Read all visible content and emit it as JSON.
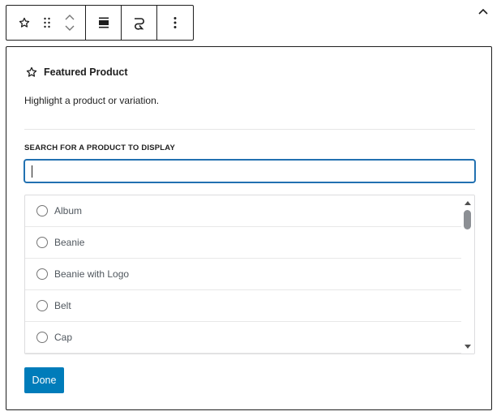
{
  "block": {
    "title": "Featured Product",
    "description": "Highlight a product or variation.",
    "search_label": "SEARCH FOR A PRODUCT TO DISPLAY",
    "search_value": "",
    "products": [
      "Album",
      "Beanie",
      "Beanie with Logo",
      "Belt",
      "Cap"
    ],
    "done_label": "Done"
  },
  "toolbar": {
    "icons": [
      "star-icon",
      "drag-handle-icon",
      "move-up-icon",
      "move-down-icon",
      "align-icon",
      "link-icon",
      "more-options-icon"
    ]
  },
  "colors": {
    "accent": "#007cba",
    "focus": "#2271b1",
    "border": "#1e1e1e",
    "muted_text": "#50575e"
  }
}
